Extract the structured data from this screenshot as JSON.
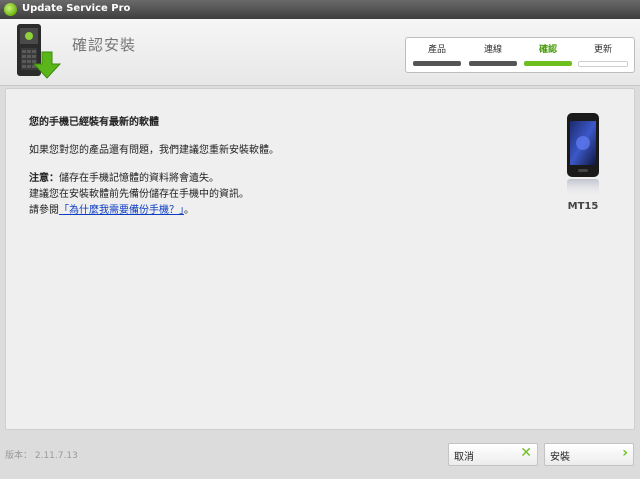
{
  "app": {
    "title": "Update Service Pro"
  },
  "header": {
    "step_title": "確認安裝"
  },
  "steps": [
    {
      "label": "產品"
    },
    {
      "label": "連線"
    },
    {
      "label": "確認"
    },
    {
      "label": "更新"
    }
  ],
  "content": {
    "heading": "您的手機已經裝有最新的軟體",
    "para1": "如果您對您的產品還有問題，我們建議您重新安裝軟體。",
    "note_label": "注意：",
    "note_text": "儲存在手機記憶體的資料將會遺失。",
    "backup_text": "建議您在安裝軟體前先備份儲存在手機中的資訊。",
    "see_prefix": "請參閱",
    "see_link": "「為什麼我需要備份手機？」",
    "see_suffix": "。"
  },
  "device": {
    "model": "MT15"
  },
  "footer": {
    "version": "版本： 2.11.7.13",
    "cancel_label": "取消",
    "install_label": "安裝"
  },
  "colors": {
    "accent": "#6cbf1e",
    "link": "#0b3cc4"
  }
}
